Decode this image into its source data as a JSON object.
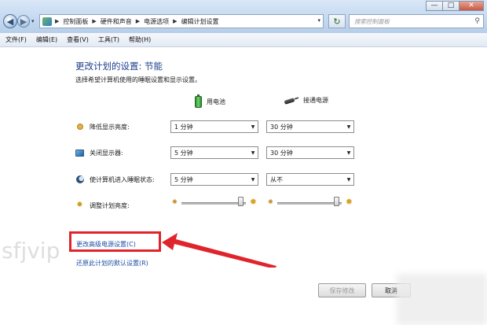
{
  "window": {
    "minimize_label": "—",
    "maximize_label": "□",
    "close_label": "✕"
  },
  "nav": {
    "back_glyph": "◀",
    "forward_glyph": "▶",
    "history_glyph": "▾"
  },
  "address": {
    "separator": "▶",
    "breadcrumbs": [
      "控制面板",
      "硬件和声音",
      "电源选项",
      "编辑计划设置"
    ],
    "dropdown_glyph": "▾"
  },
  "refresh_glyph": "↻",
  "search": {
    "placeholder": "搜索控制面板",
    "icon": "search-icon"
  },
  "menu": [
    "文件(F)",
    "编辑(E)",
    "查看(V)",
    "工具(T)",
    "帮助(H)"
  ],
  "main": {
    "title": "更改计划的设置: 节能",
    "subtitle": "选择希望计算机使用的睡眠设置和显示设置。",
    "columns": {
      "battery": "用电池",
      "plugged": "接通电源"
    },
    "rows": [
      {
        "label": "降低显示亮度:",
        "icon": "sun-icon",
        "battery": "1 分钟",
        "plugged": "30 分钟"
      },
      {
        "label": "关闭显示器:",
        "icon": "monitor-icon",
        "battery": "5 分钟",
        "plugged": "30 分钟"
      },
      {
        "label": "使计算机进入睡眠状态:",
        "icon": "moon-icon",
        "battery": "5 分钟",
        "plugged": "从不"
      }
    ],
    "brightness": {
      "label": "调整计划亮度:",
      "icon": "sun-icon",
      "battery_level_fraction": 0.92,
      "plugged_level_fraction": 0.92,
      "dim_glyph": "✺",
      "bright_glyph": "✹"
    },
    "dropdown_glyph": "▼",
    "links": {
      "advanced": "更改高级电源设置(C)",
      "restore": "还原此计划的默认设置(R)"
    },
    "buttons": {
      "save": "保存修改",
      "cancel": "取消"
    }
  },
  "annotation": {
    "highlight_color": "#e0242b"
  },
  "watermark": "sfjvip"
}
